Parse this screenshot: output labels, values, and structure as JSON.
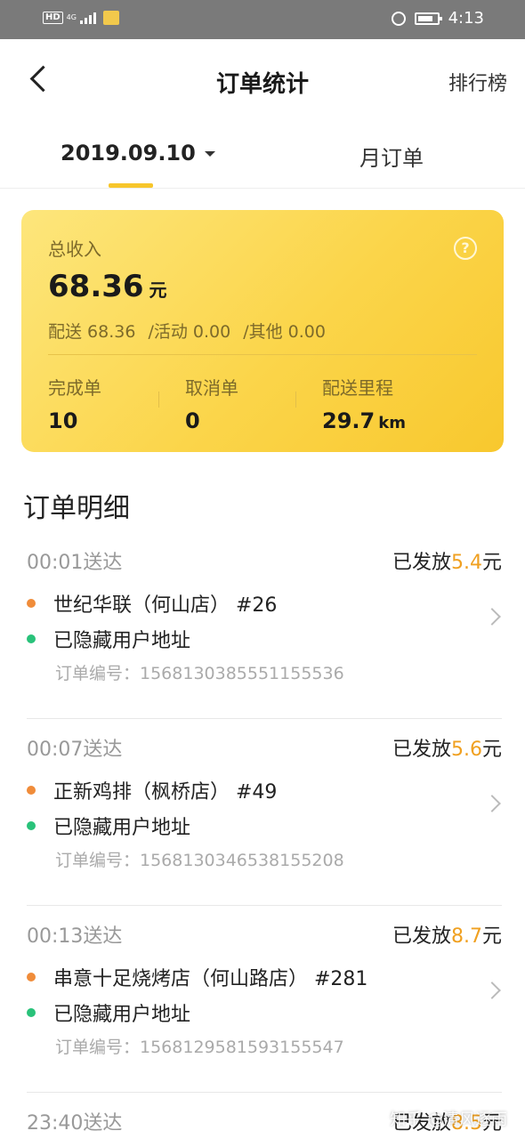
{
  "status_bar": {
    "hd": "HD",
    "network": "4G",
    "time": "4:13"
  },
  "nav": {
    "title": "订单统计",
    "right_label": "排行榜"
  },
  "tabs": {
    "date": "2019.09.10",
    "month": "月订单"
  },
  "summary": {
    "label": "总收入",
    "amount": "68.36",
    "unit": "元",
    "delivery": "配送 68.36",
    "activity": "/活动 0.00",
    "other": "/其他 0.00",
    "stats": [
      {
        "label": "完成单",
        "value": "10",
        "unit": ""
      },
      {
        "label": "取消单",
        "value": "0",
        "unit": ""
      },
      {
        "label": "配送里程",
        "value": "29.7",
        "unit": "km"
      }
    ]
  },
  "orders_section": {
    "title": "订单明细"
  },
  "orders": [
    {
      "time": "00:01送达",
      "pay_prefix": "已发放",
      "pay_amount": "5.4",
      "pay_unit": "元",
      "store": "世纪华联（何山店） #26",
      "address": "已隐藏用户地址",
      "order_no": "订单编号：1568130385551155536"
    },
    {
      "time": "00:07送达",
      "pay_prefix": "已发放",
      "pay_amount": "5.6",
      "pay_unit": "元",
      "store": "正新鸡排（枫桥店） #49",
      "address": "已隐藏用户地址",
      "order_no": "订单编号：1568130346538155208"
    },
    {
      "time": "00:13送达",
      "pay_prefix": "已发放",
      "pay_amount": "8.7",
      "pay_unit": "元",
      "store": "串意十足烧烤店（何山路店） #281",
      "address": "已隐藏用户地址",
      "order_no": "订单编号：1568129581593155547"
    },
    {
      "time": "23:40送达",
      "pay_prefix": "已发放",
      "pay_amount": "8.5",
      "pay_unit": "元"
    }
  ],
  "colors": {
    "accent": "#f7c62b",
    "pay_amount": "#f0a020",
    "store_dot": "#f08c3a",
    "address_dot": "#29c27a"
  },
  "watermark": "知乎 @清风逐雨"
}
